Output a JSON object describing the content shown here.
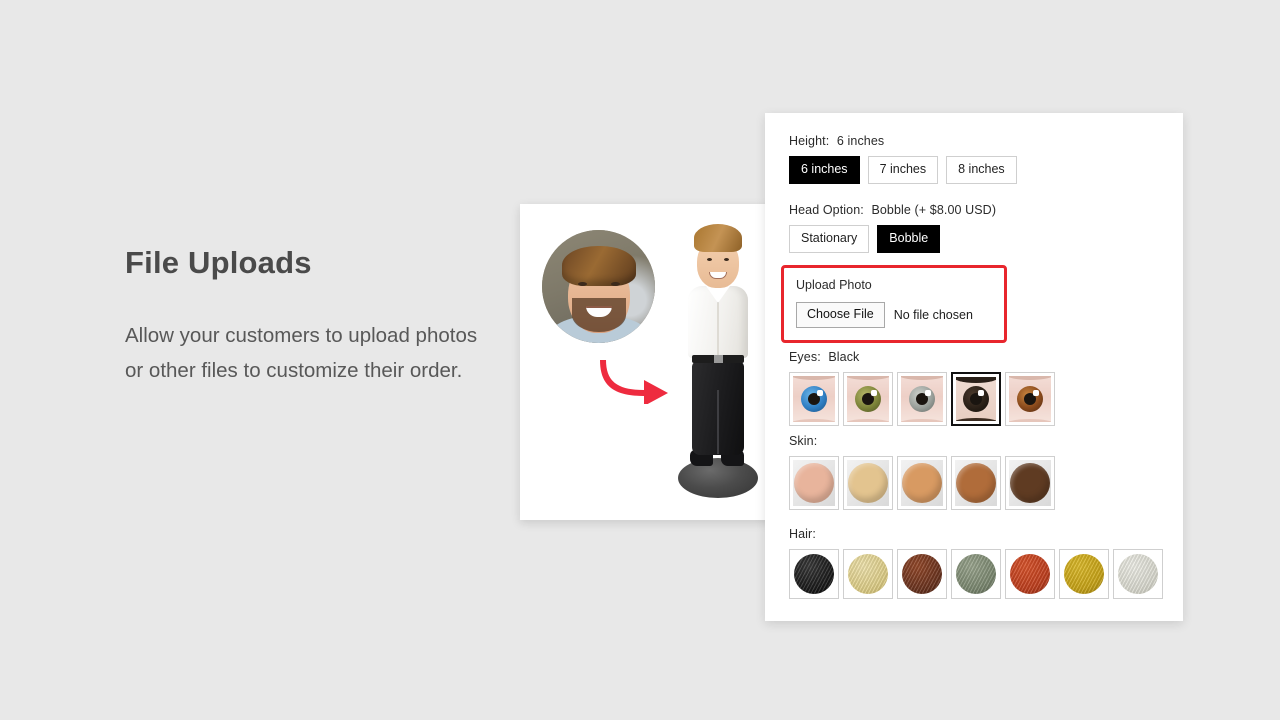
{
  "slide": {
    "headline": "File Uploads",
    "subcopy": "Allow your customers to upload photos or other files to customize their order."
  },
  "product_card": {
    "photo_alt": "customer-portrait-photo",
    "arrow_alt": "red-curved-arrow",
    "figurine_alt": "custom-bobblehead-figurine",
    "arrow_color": "#ee2b3f"
  },
  "options": {
    "height": {
      "label": "Height:",
      "value": "6 inches",
      "choices": [
        {
          "label": "6 inches",
          "selected": true
        },
        {
          "label": "7 inches",
          "selected": false
        },
        {
          "label": "8 inches",
          "selected": false
        }
      ]
    },
    "head_option": {
      "label": "Head Option:",
      "value": "Bobble  (+ $8.00 USD)",
      "choices": [
        {
          "label": "Stationary",
          "selected": false
        },
        {
          "label": "Bobble",
          "selected": true
        }
      ]
    },
    "upload": {
      "title": "Upload Photo",
      "button_label": "Choose File",
      "file_status": "No file chosen",
      "highlight_color": "#e8262d"
    },
    "eyes": {
      "label": "Eyes:",
      "value": "Black",
      "choices": [
        {
          "name": "Blue",
          "iris": "#2f7fc4",
          "selected": false
        },
        {
          "name": "Green",
          "iris": "#7d8439",
          "selected": false
        },
        {
          "name": "Gray",
          "iris": "#9aa09b",
          "selected": false
        },
        {
          "name": "Black",
          "iris": "#2b2118",
          "selected": true
        },
        {
          "name": "Brown",
          "iris": "#8a4a1c",
          "selected": false
        }
      ]
    },
    "skin": {
      "label": "Skin:",
      "choices": [
        {
          "name": "Fair",
          "color": "#e8b49c",
          "selected": false
        },
        {
          "name": "Light",
          "color": "#e3c48f",
          "selected": false
        },
        {
          "name": "Medium",
          "color": "#d89a62",
          "selected": false
        },
        {
          "name": "Tan",
          "color": "#b06c3a",
          "selected": false
        },
        {
          "name": "Dark",
          "color": "#5f3b22",
          "selected": false
        }
      ]
    },
    "hair": {
      "label": "Hair:",
      "choices": [
        {
          "name": "Black",
          "color": "#1c1c1c",
          "selected": false
        },
        {
          "name": "Blonde",
          "color": "#e0d08a",
          "selected": false
        },
        {
          "name": "Auburn",
          "color": "#6d3520",
          "selected": false
        },
        {
          "name": "Gray",
          "color": "#7d8a72",
          "selected": false
        },
        {
          "name": "Red",
          "color": "#c0401f",
          "selected": false
        },
        {
          "name": "Gold",
          "color": "#c9a518",
          "selected": false
        },
        {
          "name": "White",
          "color": "#dcdcd2",
          "selected": false
        }
      ]
    }
  }
}
